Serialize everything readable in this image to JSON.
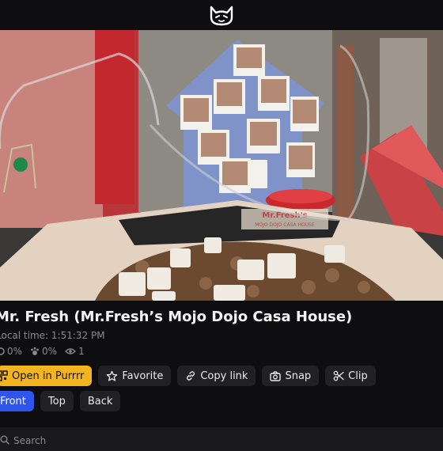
{
  "header": {
    "logo_icon": "cat-face-logo-icon"
  },
  "stream": {
    "title": "Mr. Fresh (Mr.Fresh’s Mojo Dojo Casa House)",
    "local_time": "Local time: 1:51:32 PM",
    "stats": [
      {
        "icon": "percent-icon",
        "value": "0%"
      },
      {
        "icon": "paw-icon",
        "value": "0%"
      },
      {
        "icon": "eye-icon",
        "value": "1"
      }
    ],
    "image_overlay_text": {
      "mat_brand": "Mr.Fresh's",
      "mat_sub": "MOJO DOJO CASA HOUSE"
    }
  },
  "actions": {
    "open_label": "Open in Purrrr",
    "favorite_label": "Favorite",
    "copy_link_label": "Copy link",
    "snap_label": "Snap",
    "clip_label": "Clip"
  },
  "camera_controls": {
    "front_label": "Front",
    "top_label": "Top",
    "back_label": "Back",
    "selected": "Front"
  },
  "search": {
    "placeholder": "Search"
  },
  "colors": {
    "background": "#0e0e10",
    "button": "#212124",
    "primary_button": "#f2b51f",
    "selected_button": "#2f55ee",
    "muted_text": "#8a8a8e"
  }
}
